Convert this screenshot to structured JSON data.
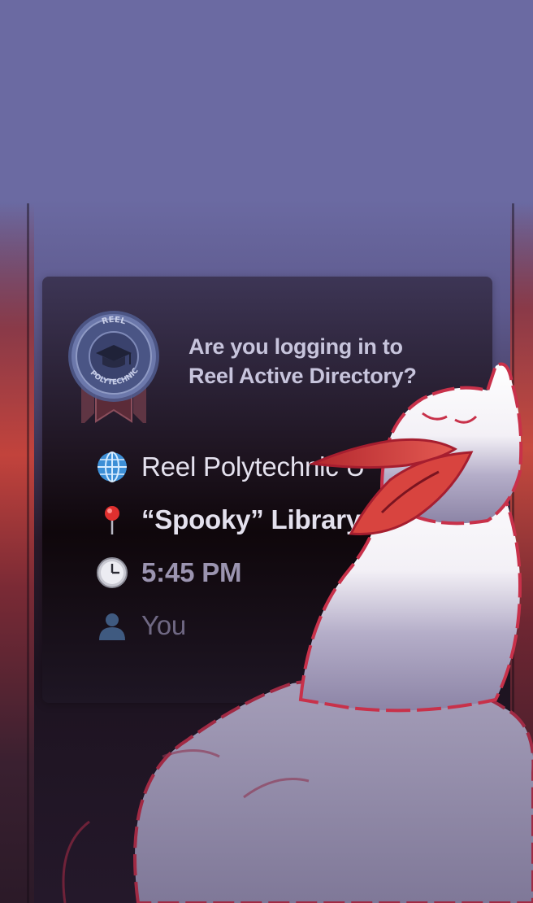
{
  "prompt": {
    "question_line1": "Are you logging in to",
    "question_line2": "Reel Active Directory?"
  },
  "seal": {
    "top_text": "REEL",
    "bottom_text": "POLYTECHNIC"
  },
  "details": [
    {
      "icon": "globe-icon",
      "text": "Reel Polytechnic U"
    },
    {
      "icon": "pushpin-icon",
      "text": "“Spooky” Library"
    },
    {
      "icon": "clock-icon",
      "text": "5:45 PM"
    },
    {
      "icon": "person-icon",
      "text": "You"
    }
  ],
  "colors": {
    "background_top": "#6b6aa2",
    "card": "#1a1018",
    "accent_red": "#c2433c",
    "goose_outline": "#c8314a"
  }
}
